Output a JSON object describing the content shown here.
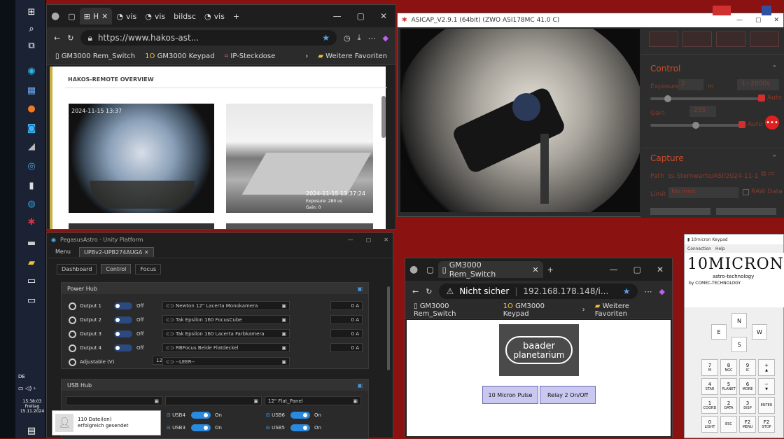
{
  "taskbar": {
    "lang": "DE",
    "time": "15:38:03",
    "day": "Freitag",
    "date": "15.11.2024"
  },
  "hakos": {
    "tabs": [
      "H",
      "vis",
      "vis",
      "bildsc",
      "vis"
    ],
    "url": "https://www.hakos-ast...",
    "favorites": [
      "GM3000 Rem_Switch",
      "GM3000 Keypad",
      "IP-Steckdose"
    ],
    "more_favorites": "Weitere Favoriten",
    "heading": "HAKOS-REMOTE OVERVIEW",
    "cam1_timestamp": "2024-11-15 13:37",
    "cam2_timestamp": "2024-11-15 13:37:24",
    "cam2_exposure": "Exposure: 280 us",
    "cam2_gain": "Gain: 0"
  },
  "asicap": {
    "title": "ASICAP_V2.9.1 (64bit) (ZWO ASI178MC 41.0 C)",
    "control_title": "Control",
    "exposure_label": "Exposure",
    "exposure_value": "2",
    "exposure_unit": "m",
    "exposure_range": "1~2000s",
    "auto_label": "Auto",
    "gain_label": "Gain",
    "gain_value": "255",
    "capture_title": "Capture",
    "path_label": "Path",
    "path_value": "ts-Sternwarte/ASI/2024-11-13",
    "limit_label": "Limit",
    "limit_value": "No limit",
    "raw_label": "RAW Data"
  },
  "pegasus": {
    "title": "PegasusAstro · Unity Platform",
    "menu": "Menu",
    "device_tab": "UPBv2-UPB274AUGA",
    "tabs": [
      "Dashboard",
      "Control",
      "Focus"
    ],
    "power_hub": "Power Hub",
    "outputs": [
      {
        "label": "Output 1",
        "state": "Off",
        "name": "Newton 12\" Lacerta Monokamera",
        "amps": "0 A"
      },
      {
        "label": "Output 2",
        "state": "Off",
        "name": "Tak Epsilon 160 FocusCube",
        "amps": "0 A"
      },
      {
        "label": "Output 3",
        "state": "Off",
        "name": "Tak Epsilon 160 Lacerta Farbkamera",
        "amps": "0 A"
      },
      {
        "label": "Output 4",
        "state": "Off",
        "name": "RBFocus Beide Flatdeckel",
        "amps": "0 A"
      }
    ],
    "adjustable_label": "Adjustable (V)",
    "adjustable_value": "12",
    "adjustable_name": "--LEER--",
    "usb_hub": "USB Hub",
    "usb_field": "12\" Flat_Panel",
    "usb": [
      {
        "label": "USB4",
        "state": "On"
      },
      {
        "label": "USB6",
        "state": "On"
      },
      {
        "label": "USB3",
        "state": "On"
      },
      {
        "label": "USB5",
        "state": "On"
      }
    ]
  },
  "toast": {
    "text": "110 Datei(en) erfolgreich gesendet"
  },
  "gm": {
    "tab": "GM3000 Rem_Switch",
    "not_secure": "Nicht sicher",
    "url": "192.168.178.148/i...",
    "favorites": [
      "GM3000 Rem_Switch",
      "GM3000 Keypad"
    ],
    "more_favorites": "Weitere Favoriten",
    "logo_line1": "baader",
    "logo_line2": "planetarium",
    "btn1": "10 Micron Pulse",
    "btn2": "Relay 2 On/Off"
  },
  "keypad": {
    "title": "10micron Keypad",
    "menu": [
      "Connection",
      "Help"
    ],
    "brand": "10MICRON",
    "brand_sub": "astro-technology",
    "by": "by COMEC-TECHNOLOGY",
    "dirs": {
      "n": "N",
      "s": "S",
      "e": "E",
      "w": "W"
    },
    "keys": [
      {
        "num": "7",
        "txt": "M"
      },
      {
        "num": "8",
        "txt": "NGC"
      },
      {
        "num": "9",
        "txt": "IC"
      },
      {
        "num": "+",
        "txt": "▲"
      },
      {
        "num": "4",
        "txt": "STAR"
      },
      {
        "num": "5",
        "txt": "PLANET"
      },
      {
        "num": "6",
        "txt": "MORE"
      },
      {
        "num": "−",
        "txt": "▼"
      },
      {
        "num": "1",
        "txt": "COORD"
      },
      {
        "num": "2",
        "txt": "DATA"
      },
      {
        "num": "3",
        "txt": "DISP"
      },
      {
        "num": "",
        "txt": "ENTER"
      },
      {
        "num": "0",
        "txt": "LIGHT"
      },
      {
        "num": "",
        "txt": "ESC"
      },
      {
        "num": "F2",
        "txt": "MENU"
      },
      {
        "num": "F2",
        "txt": "STOP"
      }
    ]
  },
  "colors": {
    "desktop": "#8a1210",
    "accent_red": "#d03030",
    "toggle_blue": "#2a8ae0"
  }
}
